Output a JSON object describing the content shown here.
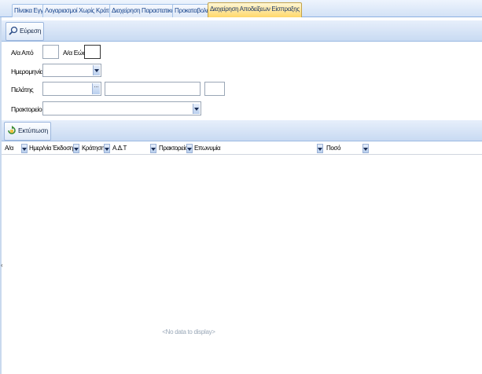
{
  "tabs": [
    {
      "label": "Πίνακα Εγγρ/ή"
    },
    {
      "label": "Λογαριασμοί Χωρίς Κράτηση"
    },
    {
      "label": "Διαχείρηση Παραστατικών"
    },
    {
      "label": "Προκαταβολές"
    },
    {
      "label": "Διαχείρηση Αποδείξεων Είσπραξης"
    }
  ],
  "toolbar_search": {
    "label": "Εύρεση",
    "icon": "magnifier-icon"
  },
  "filters": {
    "aa_from_label": "Α/α Από",
    "aa_from_value": "",
    "aa_to_label": "Α/α Εώς",
    "aa_to_value": "",
    "date_label": "Ημερομηνία",
    "date_value": "",
    "customer_label": "Πελάτης",
    "customer_code": "",
    "customer_name": "",
    "customer_extra": "",
    "customer_lookup": "...",
    "agency_label": "Πρακτορείο",
    "agency_value": ""
  },
  "toolbar_print": {
    "label": "Εκτύπωση",
    "icon": "print-icon"
  },
  "grid": {
    "columns": [
      "Α/α",
      "Ημερ/νία Έκδοσης",
      "Κράτηση",
      "Α.Δ.Τ",
      "Πρακτορείο",
      "Επωνυμία",
      "Ποσό"
    ],
    "empty_text": "<No data to display>"
  },
  "colors": {
    "accent": "#ffd45e",
    "toolbar": "#c8daf2",
    "text_blue": "#15428b"
  }
}
